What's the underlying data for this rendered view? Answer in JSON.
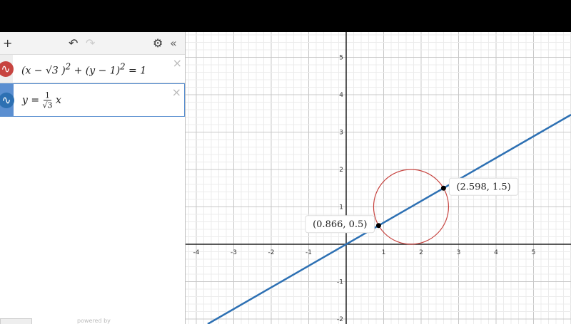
{
  "toolbar": {
    "add": "+",
    "undo": "↶",
    "redo": "↷",
    "settings": "⚙",
    "collapse": "«"
  },
  "expressions": [
    {
      "color": "#c74440",
      "icon": "∿",
      "latex_parts": [
        "(x − √3 )",
        "2",
        " + (y − 1)",
        "2",
        " = 1"
      ],
      "close": "×"
    },
    {
      "color": "#2d70b3",
      "icon": "∿",
      "lhs": "y = ",
      "num": "1",
      "den": "√3",
      "rhs": "x",
      "close": "×"
    }
  ],
  "footer": {
    "powered_by": "powered by"
  },
  "chart_data": {
    "type": "line",
    "xlim": [
      -4.3,
      6
    ],
    "ylim": [
      -2.1,
      5.7
    ],
    "x_ticks": [
      -4,
      -3,
      -2,
      -1,
      1,
      2,
      3,
      4,
      5
    ],
    "y_ticks": [
      -2,
      -1,
      1,
      2,
      3,
      4,
      5
    ],
    "grid": true,
    "circle": {
      "cx": 1.732,
      "cy": 1,
      "r": 1,
      "color": "#c74440"
    },
    "line": {
      "slope": 0.57735,
      "intercept": 0,
      "color": "#2d70b3"
    },
    "points": [
      {
        "x": 0.866,
        "y": 0.5,
        "label": "(0.866, 0.5)"
      },
      {
        "x": 2.598,
        "y": 1.5,
        "label": "(2.598, 1.5)"
      }
    ]
  }
}
